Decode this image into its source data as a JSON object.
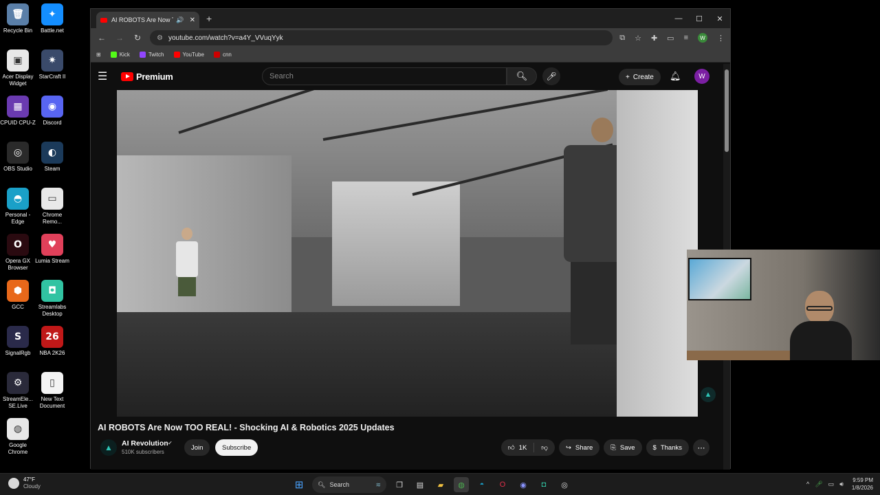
{
  "desktop": {
    "icons": [
      {
        "label": "Recycle Bin",
        "glyph": "🗑",
        "color": "#5a7fa8"
      },
      {
        "label": "Battle.net",
        "glyph": "✦",
        "color": "#148eff"
      },
      {
        "label": "Acer Display Widget",
        "glyph": "▣",
        "color": "#e8e8e8"
      },
      {
        "label": "StarCraft II",
        "glyph": "✷",
        "color": "#3a4a6a"
      },
      {
        "label": "CPUID CPU-Z",
        "glyph": "▦",
        "color": "#6a3ab0"
      },
      {
        "label": "Discord",
        "glyph": "◉",
        "color": "#5865f2"
      },
      {
        "label": "OBS Studio",
        "glyph": "◎",
        "color": "#2a2a2a"
      },
      {
        "label": "Steam",
        "glyph": "◐",
        "color": "#1b3a5a"
      },
      {
        "label": "Personal - Edge",
        "glyph": "◓",
        "color": "#1aa0c8"
      },
      {
        "label": "Chrome Remo...",
        "glyph": "▭",
        "color": "#e8e8e8"
      },
      {
        "label": "Opera GX Browser",
        "glyph": "O",
        "color": "#2a0a10"
      },
      {
        "label": "Lumia Stream",
        "glyph": "♥",
        "color": "#e0405a"
      },
      {
        "label": "GCC",
        "glyph": "⬢",
        "color": "#e8681a"
      },
      {
        "label": "Streamlabs Desktop",
        "glyph": "◘",
        "color": "#31c3a2"
      },
      {
        "label": "SignalRgb",
        "glyph": "S",
        "color": "#2a2a4a"
      },
      {
        "label": "NBA 2K26",
        "glyph": "26",
        "color": "#c01818"
      },
      {
        "label": "StreamEle... SE.Live",
        "glyph": "⚙",
        "color": "#2a2a3a"
      },
      {
        "label": "New Text Document",
        "glyph": "▯",
        "color": "#f4f4f4"
      },
      {
        "label": "Google Chrome",
        "glyph": "◍",
        "color": "#e8e8e8"
      }
    ]
  },
  "browser": {
    "tab_title": "AI ROBOTS Are Now TOO REAL!",
    "url": "youtube.com/watch?v=a4Y_VVuqYyk",
    "bookmarks": [
      {
        "label": "Kick",
        "color": "#53fc18"
      },
      {
        "label": "Twitch",
        "color": "#9146ff"
      },
      {
        "label": "YouTube",
        "color": "#ff0000"
      },
      {
        "label": "cnn",
        "color": "#cc0000"
      }
    ],
    "profile_initial": "W"
  },
  "youtube": {
    "logo_text": "Premium",
    "search_placeholder": "Search",
    "create_label": "Create",
    "avatar_initial": "W",
    "video_title": "AI ROBOTS Are Now TOO REAL! - Shocking AI & Robotics 2025 Updates",
    "channel_name": "AI Revolution",
    "subscribers": "510K subscribers",
    "join_label": "Join",
    "subscribe_label": "Subscribe",
    "likes": "1K",
    "share_label": "Share",
    "save_label": "Save",
    "thanks_label": "Thanks"
  },
  "taskbar": {
    "temperature": "47°F",
    "condition": "Cloudy",
    "search_label": "Search",
    "time": "9:59 PM",
    "date": "1/8/2026"
  }
}
